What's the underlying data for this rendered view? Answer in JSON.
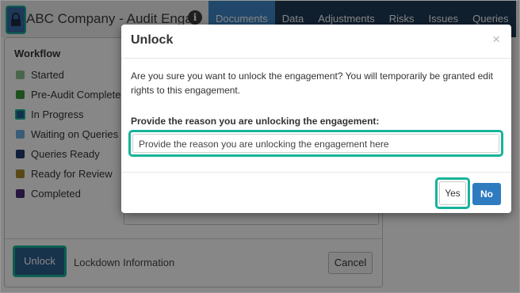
{
  "app": {
    "title": "ABC Company - Audit Enga",
    "info_icon": "info-icon",
    "lock_icon": "lock-icon"
  },
  "nav": {
    "tabs": [
      {
        "label": "Documents",
        "active": true
      },
      {
        "label": "Data"
      },
      {
        "label": "Adjustments"
      },
      {
        "label": "Risks"
      },
      {
        "label": "Issues"
      },
      {
        "label": "Queries"
      }
    ]
  },
  "workflow": {
    "heading": "Workflow",
    "steps": [
      {
        "label": "Started",
        "color": "#8cc08c"
      },
      {
        "label": "Pre-Audit Complete",
        "color": "#3a9a3a"
      },
      {
        "label": "In Progress",
        "color": "#1f5f8f",
        "current": true
      },
      {
        "label": "Waiting on Queries",
        "color": "#6fb0e0"
      },
      {
        "label": "Queries Ready",
        "color": "#1f3b6f"
      },
      {
        "label": "Ready for Review",
        "color": "#a88a2a"
      },
      {
        "label": "Completed",
        "color": "#4a2a7a"
      }
    ],
    "unlock_label": "Unlock",
    "lockdown_info_label": "Lockdown Information",
    "cancel_label": "Cancel"
  },
  "modal": {
    "title": "Unlock",
    "close_symbol": "×",
    "message": "Are you sure you want to unlock the engagement? You will temporarily be granted edit rights to this engagement.",
    "reason_label": "Provide the reason you are unlocking the engagement:",
    "reason_placeholder": "Provide the reason you are unlocking the engagement here",
    "yes_label": "Yes",
    "no_label": "No"
  },
  "colors": {
    "highlight": "#17b39a",
    "nav_bg": "#1f3b57",
    "nav_active": "#3f88c9",
    "primary_button": "#2f7bc0"
  }
}
